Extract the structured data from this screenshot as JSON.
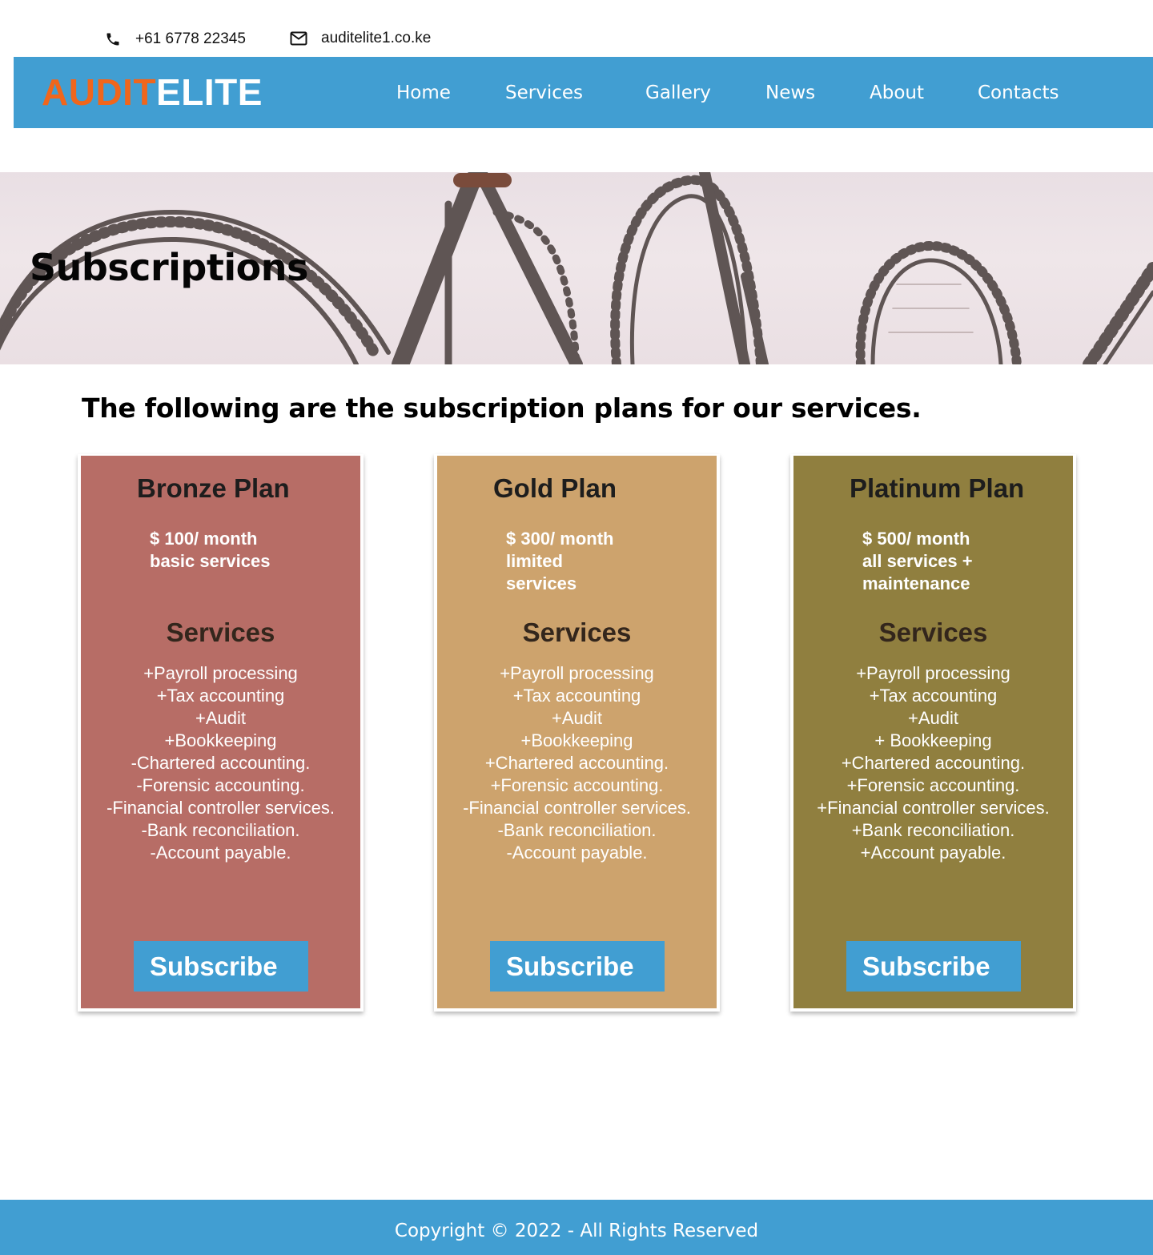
{
  "contact": {
    "phone_icon": "phone-icon",
    "phone": "+61 6778 22345",
    "email_icon": "mail-icon",
    "email": "auditelite1.co.ke"
  },
  "header": {
    "logo_part1": "AUDIT",
    "logo_part2": "ELITE",
    "nav": [
      "Home",
      "Services",
      "Gallery",
      "News",
      "About",
      "Contacts"
    ]
  },
  "hero": {
    "title": "Subscriptions"
  },
  "intro": "The following are the subscription plans for our services.",
  "plans": [
    {
      "name": "Bronze Plan",
      "price_lines": [
        "$ 100/ month",
        "basic services"
      ],
      "services_heading": "Services",
      "services": [
        "+Payroll processing",
        "+Tax accounting",
        "+Audit",
        "+Bookkeeping",
        "-Chartered accounting.",
        "-Forensic accounting.",
        "-Financial controller services.",
        "-Bank reconciliation.",
        "-Account payable."
      ],
      "button": "Subscribe",
      "color": "#b76d66"
    },
    {
      "name": "Gold Plan",
      "price_lines": [
        "$ 300/ month",
        "limited",
        "services"
      ],
      "services_heading": "Services",
      "services": [
        "+Payroll processing",
        "+Tax accounting",
        "+Audit",
        "+Bookkeeping",
        "+Chartered accounting.",
        "+Forensic accounting.",
        "-Financial controller services.",
        "-Bank reconciliation.",
        "-Account payable."
      ],
      "button": "Subscribe",
      "color": "#cda36d"
    },
    {
      "name": "Platinum Plan",
      "price_lines": [
        "$ 500/ month",
        "all services +",
        "maintenance"
      ],
      "services_heading": "Services",
      "services": [
        "+Payroll processing",
        "+Tax accounting",
        "+Audit",
        "+ Bookkeeping",
        "+Chartered accounting.",
        "+Forensic accounting.",
        "+Financial controller services.",
        "+Bank reconciliation.",
        "+Account payable."
      ],
      "button": "Subscribe",
      "color": "#907f3f"
    }
  ],
  "footer": {
    "copyright": "Copyright © 2022 - All Rights Reserved"
  },
  "colors": {
    "accent": "#419ed2",
    "logo_orange": "#f0661c"
  }
}
